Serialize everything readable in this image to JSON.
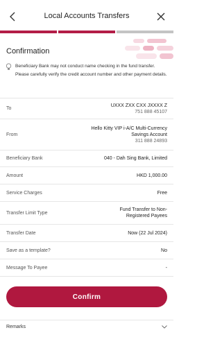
{
  "header": {
    "title": "Local Accounts Transfers",
    "back_icon": "back-chevron-icon",
    "close_icon": "close-icon",
    "progress_steps": 3,
    "progress_active": 2
  },
  "confirmation": {
    "title": "Confirmation"
  },
  "notice": {
    "icon": "lightbulb-icon",
    "text": "Beneficiary Bank may not conduct name checking in the fund transfer. Please carefully verify the credit account number and other payment details."
  },
  "details": [
    {
      "key": "To",
      "value": "UXXX ZXX CXX JXXXX Z",
      "sub": "751 888 45107"
    },
    {
      "key": "From",
      "value": "Hello Kitty VIP i-A/C Multi-Currency Savings Account",
      "sub": "311 888 24893"
    },
    {
      "key": "Beneficiary Bank",
      "value": "040 - Dah Sing Bank, Limited",
      "sub": ""
    },
    {
      "key": "Amount",
      "value": "HKD 1,000.00",
      "sub": ""
    },
    {
      "key": "Service Charges",
      "value": "Free",
      "sub": ""
    },
    {
      "key": "Transfer Limit Type",
      "value": "Fund Transfer to Non-Registered Payees",
      "sub": ""
    },
    {
      "key": "Transfer Date",
      "value": "Now (22 Jul 2024)",
      "sub": ""
    },
    {
      "key": "Save as a template?",
      "value": "No",
      "sub": ""
    },
    {
      "key": "Message To Payee",
      "value": "-",
      "sub": ""
    }
  ],
  "actions": {
    "confirm_label": "Confirm"
  },
  "remarks": {
    "label": "Remarks",
    "icon": "chevron-down-icon"
  },
  "colors": {
    "accent": "#b0183f",
    "progress_inactive": "#c4c4c4",
    "divider": "#e6e6e6"
  }
}
